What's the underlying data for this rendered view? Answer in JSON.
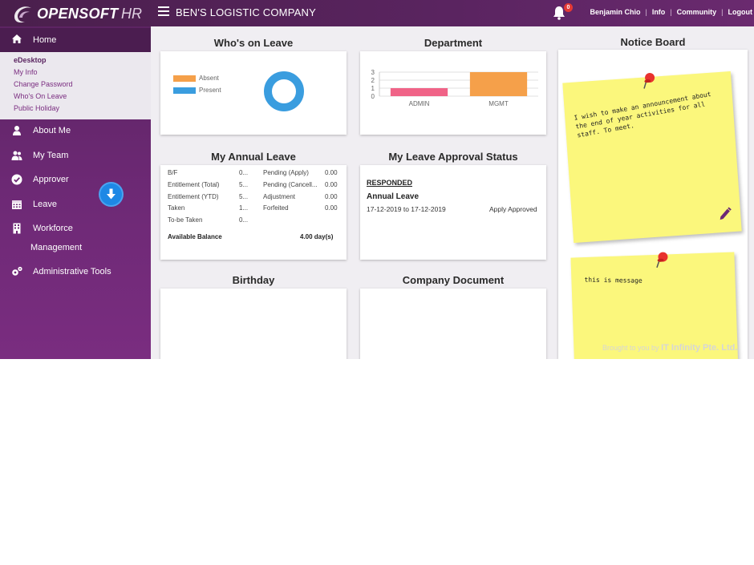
{
  "header": {
    "logo_text": "OPENSOFT",
    "logo_suffix": "HR",
    "company": "BEN'S LOGISTIC COMPANY",
    "notification_count": "0",
    "user": "Benjamin Chio",
    "links": [
      "Info",
      "Community",
      "Logout"
    ]
  },
  "sidebar": {
    "home": "Home",
    "submenu": [
      "eDesktop",
      "My Info",
      "Change Password",
      "Who's On Leave",
      "Public Holiday"
    ],
    "items": [
      "About Me",
      "My Team",
      "Approver",
      "Leave",
      "Workforce",
      "Management",
      "Administrative Tools"
    ]
  },
  "panels": {
    "whos_on_leave": {
      "title": "Who's on Leave",
      "legend": [
        "Absent",
        "Present"
      ]
    },
    "department": {
      "title": "Department"
    },
    "annual_leave": {
      "title": "My Annual Leave",
      "left": [
        {
          "label": "B/F",
          "value": "0..."
        },
        {
          "label": "Entitlement (Total)",
          "value": "5..."
        },
        {
          "label": "Entitlement (YTD)",
          "value": "5..."
        },
        {
          "label": "Taken",
          "value": "1..."
        },
        {
          "label": "To-be Taken",
          "value": "0..."
        }
      ],
      "right": [
        {
          "label": "Pending (Apply)",
          "value": "0.00"
        },
        {
          "label": "Pending (Cancell...",
          "value": "0.00"
        },
        {
          "label": "Adjustment",
          "value": "0.00"
        },
        {
          "label": "Forfeited",
          "value": "0.00"
        }
      ],
      "balance_label": "Available Balance",
      "balance_value": "4.00 day(s)"
    },
    "approval": {
      "title": "My Leave Approval Status",
      "status": "RESPONDED",
      "type": "Annual Leave",
      "dates": "17-12-2019 to 17-12-2019",
      "result": "Apply Approved"
    },
    "birthday": {
      "title": "Birthday"
    },
    "company_document": {
      "title": "Company Document"
    },
    "notice_board": {
      "title": "Notice Board",
      "notes": [
        "I wish to make an announcement about the end of year activities for all staff. To meet.",
        "this is message"
      ],
      "credit_prefix": "Brought to you by",
      "credit_company": "IT Infinity Pte. Ltd."
    }
  },
  "chart_data": [
    {
      "type": "pie",
      "categories": [
        "Absent",
        "Present"
      ],
      "values": [
        0,
        100
      ],
      "colors": [
        "#f5a04a",
        "#3a9ddf"
      ]
    },
    {
      "type": "bar",
      "categories": [
        "ADMIN",
        "MGMT"
      ],
      "values": [
        1,
        3
      ],
      "colors": [
        "#f06387",
        "#f5a04a"
      ],
      "yticks": [
        "0",
        "1",
        "2",
        "3"
      ],
      "ylim": [
        0,
        3
      ],
      "grid": true
    }
  ],
  "colors": {
    "header": "#5a2460",
    "sidebar": "#6d2975",
    "accent": "#7a2d80",
    "sticky": "#fbf77c"
  }
}
